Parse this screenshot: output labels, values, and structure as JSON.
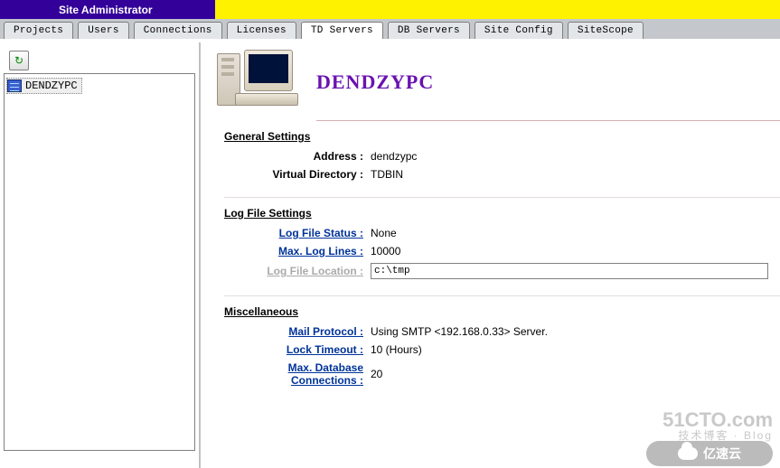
{
  "header": {
    "title": "Site Administrator"
  },
  "tabs": [
    {
      "label": "Projects",
      "key": "projects"
    },
    {
      "label": "Users",
      "key": "users"
    },
    {
      "label": "Connections",
      "key": "connections"
    },
    {
      "label": "Licenses",
      "key": "licenses"
    },
    {
      "label": "TD Servers",
      "key": "td-servers"
    },
    {
      "label": "DB Servers",
      "key": "db-servers"
    },
    {
      "label": "Site Config",
      "key": "site-config"
    },
    {
      "label": "SiteScope",
      "key": "sitescope"
    }
  ],
  "active_tab": "td-servers",
  "tree": {
    "selected": "DENDZYPC"
  },
  "server": {
    "name": "DENDZYPC",
    "sections": {
      "general": {
        "title": "General Settings",
        "rows": [
          {
            "label": "Address :",
            "value": "dendzypc",
            "link": false
          },
          {
            "label": "Virtual Directory :",
            "value": "TDBIN",
            "link": false
          }
        ]
      },
      "logfile": {
        "title": "Log File Settings",
        "rows": [
          {
            "label": "Log File Status :",
            "value": "None",
            "link": true
          },
          {
            "label": "Max. Log Lines :",
            "value": "10000",
            "link": true
          }
        ],
        "location_label": "Log File Location :",
        "location_value": "c:\\tmp"
      },
      "misc": {
        "title": "Miscellaneous",
        "rows": [
          {
            "label": "Mail Protocol :",
            "value": "Using SMTP <192.168.0.33> Server.",
            "link": true
          },
          {
            "label": "Lock Timeout :",
            "value": "10 (Hours)",
            "link": true
          },
          {
            "label": "Max. Database Connections :",
            "value": "20",
            "link": true
          }
        ]
      }
    }
  },
  "watermark": {
    "main": "51CTO.com",
    "sub": "技术博客 · Blog",
    "corner": "亿速云"
  }
}
